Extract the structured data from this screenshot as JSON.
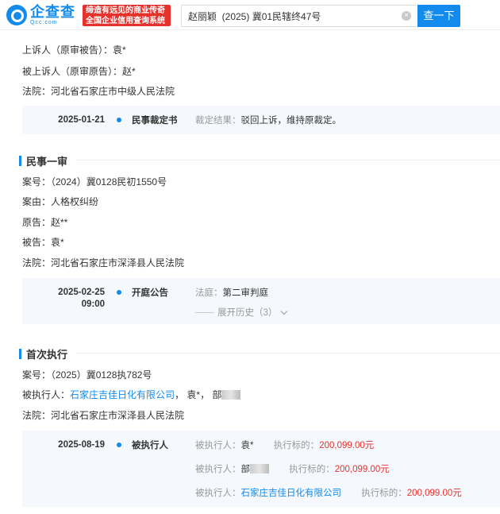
{
  "header": {
    "logo_cn": "企查查",
    "logo_en": "Qcc.com",
    "slogan_line1": "缔造有远见的商业传奇",
    "slogan_line2": "全国企业信用查询系统",
    "search_value": "赵丽颖  (2025) 冀01民辖终47号",
    "search_button": "查一下"
  },
  "appeal": {
    "appellant": "上诉人（原审被告）：袁*",
    "appellee": "被上诉人（原审原告）：赵*",
    "court": "法院：河北省石家庄市中级人民法院",
    "timeline": {
      "date": "2025-01-21",
      "type": "民事裁定书",
      "result_label": "裁定结果：",
      "result_value": "驳回上诉，维持原裁定。"
    }
  },
  "first_instance": {
    "title": "民事一审",
    "case_no": "案号：（2024）冀0128民初1550号",
    "cause": "案由：人格权纠纷",
    "plaintiff": "原告：赵**",
    "defendant": "被告：袁*",
    "court": "法院：河北省石家庄市深泽县人民法院",
    "timeline": {
      "date": "2025-02-25",
      "time": "09:00",
      "type": "开庭公告",
      "court_label": "法庭：",
      "court_value": "第二审判庭",
      "expand_label": "展开历史（3）"
    }
  },
  "execution": {
    "title": "首次执行",
    "case_no": "案号：（2025）冀0128执782号",
    "persons_label": "被执行人：",
    "person_company": "石家庄吉佳日化有限公司",
    "person_sep1": "，",
    "person_yuan": "袁*",
    "person_sep2": "，",
    "person_bu": "部",
    "court": "法院：河北省石家庄市深泽县人民法院",
    "timeline": {
      "date": "2025-08-19",
      "type": "被执行人",
      "rows": [
        {
          "label": "被执行人：",
          "name": "袁*",
          "amount_label": "执行标的：",
          "amount": "200,099.00元"
        },
        {
          "label": "被执行人：",
          "name": "部",
          "amount_label": "执行标的：",
          "amount": "200,099.00元"
        },
        {
          "label": "被执行人：",
          "name": "石家庄吉佳日化有限公司",
          "amount_label": "执行标的：",
          "amount": "200,099.00元"
        }
      ]
    }
  },
  "colors": {
    "brand": "#128bed",
    "accent_red": "#e5322d",
    "timeline_bg": "#f5f8fc"
  }
}
